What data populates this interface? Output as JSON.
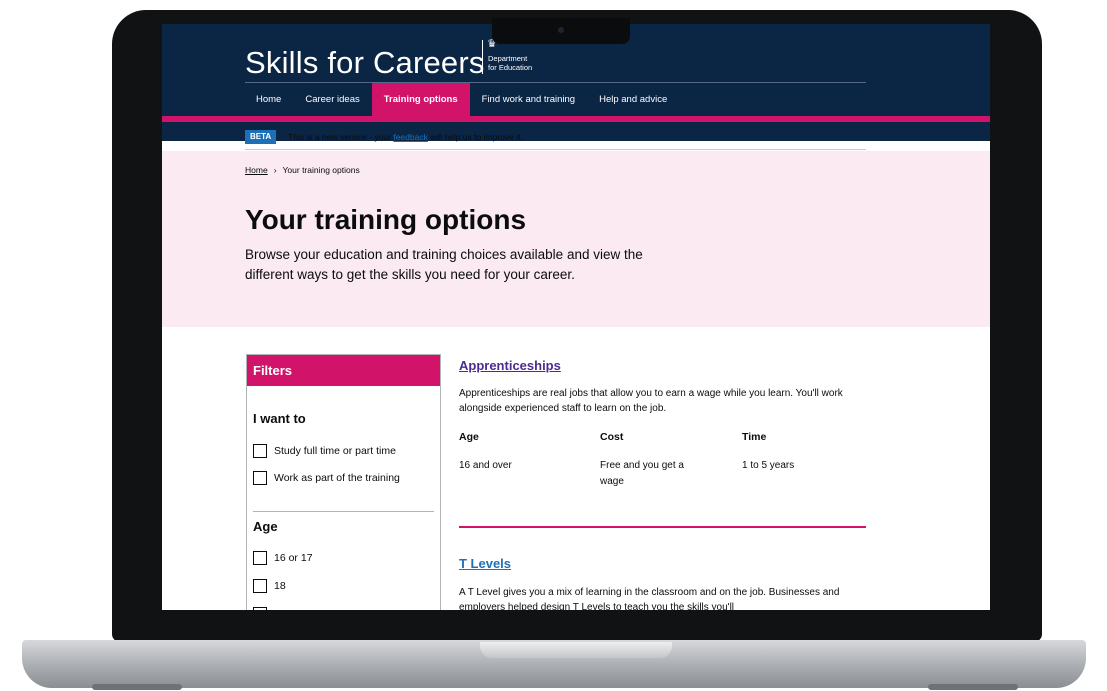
{
  "header": {
    "brand": "Skills for Careers",
    "department_line1": "Department",
    "department_line2": "for Education",
    "crest_glyph": "♛"
  },
  "nav": {
    "items": [
      {
        "label": "Home",
        "active": false
      },
      {
        "label": "Career ideas",
        "active": false
      },
      {
        "label": "Training options",
        "active": true
      },
      {
        "label": "Find work and training",
        "active": false
      },
      {
        "label": "Help and advice",
        "active": false
      }
    ]
  },
  "beta": {
    "tag": "BETA",
    "text_before": "This is a new service - your ",
    "link": "feedback",
    "text_after": " will help us to improve it."
  },
  "breadcrumb": {
    "home": "Home",
    "separator": "›",
    "current": "Your training options"
  },
  "hero": {
    "title": "Your training options",
    "lede": "Browse your education and training choices available and view the different ways to get the skills you need for your career."
  },
  "filters": {
    "heading": "Filters",
    "groups": [
      {
        "title": "I want to",
        "options": [
          "Study full time or part time",
          "Work as part of the training"
        ]
      },
      {
        "title": "Age",
        "options": [
          "16 or 17",
          "18"
        ]
      }
    ]
  },
  "results": [
    {
      "title": "Apprenticeships",
      "description": "Apprenticeships are real jobs that allow you to earn a wage while you learn. You'll work alongside experienced staff to learn on the job.",
      "columns": [
        {
          "head": "Age",
          "value": "16 and over"
        },
        {
          "head": "Cost",
          "value": "Free and you get a wage"
        },
        {
          "head": "Time",
          "value": "1 to 5 years"
        }
      ]
    },
    {
      "title": "T Levels",
      "description": "A T Level gives you a mix of learning in the classroom and on the job. Businesses and employers helped design T Levels to teach you the skills you'll"
    }
  ],
  "colors": {
    "navy": "#0b2545",
    "magenta": "#d1146a",
    "hero_bg": "#fbeaf1",
    "link_blue": "#1d70b8",
    "visited_purple": "#4c2c92"
  }
}
